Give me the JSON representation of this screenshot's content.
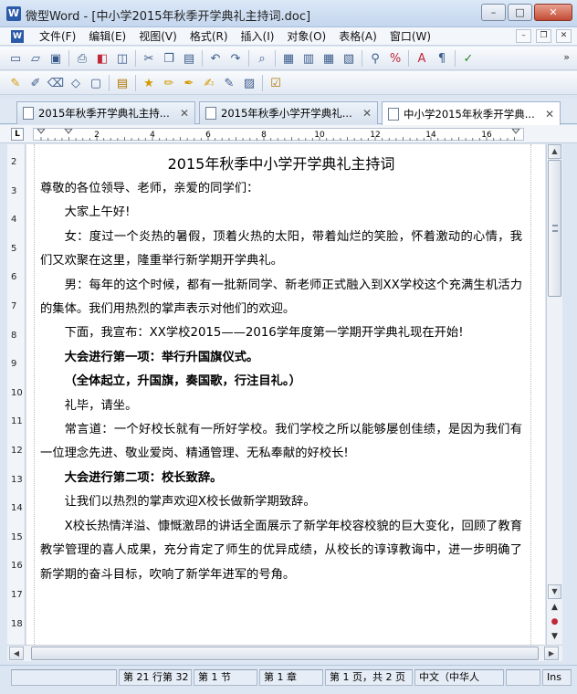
{
  "window": {
    "title": "微型Word - [中小学2015年秋季开学典礼主持词.doc]",
    "app_icon": "W",
    "controls": [
      "minimize-icon",
      "maximize-icon",
      "close-icon"
    ]
  },
  "menubar": {
    "icon_label": "W",
    "items": [
      "文件(F)",
      "编辑(E)",
      "视图(V)",
      "格式(R)",
      "插入(I)",
      "对象(O)",
      "表格(A)",
      "窗口(W)"
    ]
  },
  "toolbar1": {
    "icons": [
      "new-icon",
      "open-icon",
      "save-icon",
      "print-icon",
      "pdf-icon",
      "preview-icon",
      "cut-icon",
      "copy-icon",
      "paste-icon",
      "undo-icon",
      "redo-icon",
      "find-icon",
      "number-icon",
      "insert-field-icon",
      "table-icon",
      "columns-icon",
      "zoom-icon",
      "percent-icon",
      "font-icon",
      "style-icon",
      "spellcheck-icon"
    ],
    "overflow": "»"
  },
  "toolbar2": {
    "icons": [
      "highlight-icon",
      "edit-icon",
      "erase-icon",
      "shape-icon",
      "frame-icon",
      "clipboard-icon",
      "star-icon",
      "pencil-icon",
      "pen-icon",
      "marker-icon",
      "brush-icon",
      "note-icon",
      "review-icon"
    ]
  },
  "tabs": [
    {
      "label": "2015年秋季开学典礼主持...",
      "active": false
    },
    {
      "label": "2015年秋季小学开学典礼...",
      "active": false
    },
    {
      "label": "中小学2015年秋季开学典...",
      "active": true
    }
  ],
  "ruler": {
    "tab_selector": "L",
    "numbers": [
      "2",
      "4",
      "6",
      "8",
      "10",
      "12",
      "14",
      "16"
    ]
  },
  "vruler": {
    "numbers": [
      "2",
      "3",
      "4",
      "5",
      "6",
      "7",
      "8",
      "9",
      "10",
      "11",
      "12",
      "13",
      "14",
      "15",
      "16",
      "17",
      "18"
    ]
  },
  "document": {
    "title": "2015年秋季中小学开学典礼主持词",
    "paragraphs": [
      {
        "text": "尊敬的各位领导、老师，亲爱的同学们：",
        "indent": false,
        "bold": false
      },
      {
        "text": "大家上午好!",
        "indent": true,
        "bold": false
      },
      {
        "text": "女：度过一个炎热的暑假，顶着火热的太阳，带着灿烂的笑脸，怀着激动的心情，我们又欢聚在这里，隆重举行新学期开学典礼。",
        "indent": true,
        "bold": false
      },
      {
        "text": "男：每年的这个时候，都有一批新同学、新老师正式融入到XX学校这个充满生机活力的集体。我们用热烈的掌声表示对他们的欢迎。",
        "indent": true,
        "bold": false
      },
      {
        "text": "下面，我宣布：XX学校2015——2016学年度第一学期开学典礼现在开始!",
        "indent": true,
        "bold": false
      },
      {
        "text": "大会进行第一项：举行升国旗仪式。",
        "indent": true,
        "bold": true
      },
      {
        "text": "（全体起立，升国旗，奏国歌，行注目礼。）",
        "indent": true,
        "bold": true
      },
      {
        "text": "礼毕，请坐。",
        "indent": true,
        "bold": false
      },
      {
        "text": "常言道：一个好校长就有一所好学校。我们学校之所以能够屡创佳绩，是因为我们有一位理念先进、敬业爱岗、精通管理、无私奉献的好校长!",
        "indent": true,
        "bold": false
      },
      {
        "text": "大会进行第二项：校长致辞。",
        "indent": true,
        "bold": true
      },
      {
        "text": "让我们以热烈的掌声欢迎X校长做新学期致辞。",
        "indent": true,
        "bold": false
      },
      {
        "text": "X校长热情洋溢、慷慨激昂的讲话全面展示了新学年校容校貌的巨大变化，回顾了教育教学管理的喜人成果，充分肯定了师生的优异成绩，从校长的谆谆教诲中，进一步明确了新学期的奋斗目标，吹响了新学年进军的号角。",
        "indent": true,
        "bold": false
      }
    ]
  },
  "scrollbar": {
    "up": "▲",
    "down": "▼",
    "left": "◀",
    "right": "▶",
    "nav_prev": "▲",
    "nav_dot": "●",
    "nav_next": "▼"
  },
  "status": {
    "cells": [
      "",
      "第 21 行第 32",
      "第 1 节",
      "第 1 章",
      "第 1 页，共 2 页",
      "中文（中华人",
      "",
      "Ins"
    ]
  },
  "colors": {
    "frame": "#dce6f2",
    "title_bar": "#c4d6ee",
    "close_button": "#c24b34",
    "page": "#ffffff"
  }
}
